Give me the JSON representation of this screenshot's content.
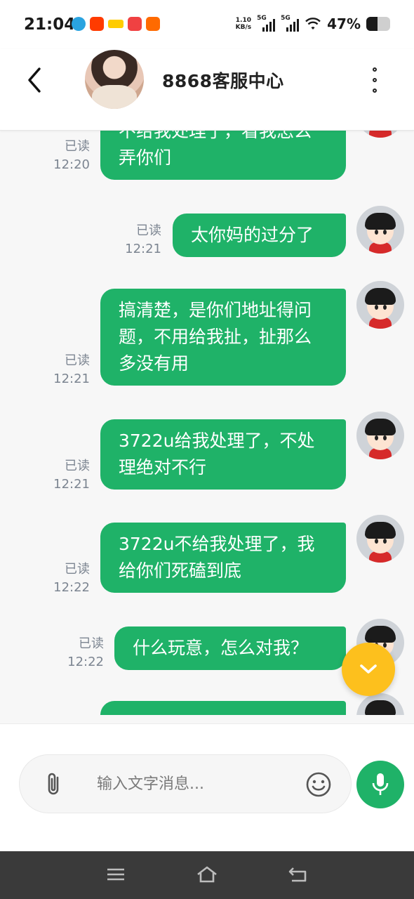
{
  "status_bar": {
    "time": "21:04",
    "net_speed_value": "1.10",
    "net_speed_unit": "KB/s",
    "signal1_label": "5G",
    "signal2_label": "5G",
    "battery_percent": "47%",
    "battery_level": 0.47
  },
  "header": {
    "title": "8868客服中心"
  },
  "messages": [
    {
      "text": "不给我处理了，看我怎么弄你们",
      "status": "已读",
      "time": "12:20"
    },
    {
      "text": "太你妈的过分了",
      "status": "已读",
      "time": "12:21"
    },
    {
      "text": "搞清楚，是你们地址得问题，不用给我扯，扯那么多没有用",
      "status": "已读",
      "time": "12:21"
    },
    {
      "text": "3722u给我处理了，不处理绝对不行",
      "status": "已读",
      "time": "12:21"
    },
    {
      "text": "3722u不给我处理了，我给你们死磕到底",
      "status": "已读",
      "time": "12:22"
    },
    {
      "text": "什么玩意，怎么对我？",
      "status": "已读",
      "time": "12:22"
    },
    {
      "text": "",
      "status": "",
      "time": ""
    }
  ],
  "composer": {
    "placeholder": "输入文字消息..."
  },
  "colors": {
    "bubble": "#1fb268",
    "fab": "#fdc01d",
    "mic": "#1fb268"
  },
  "icons": {
    "back": "chevron-left",
    "menu": "more-vertical",
    "attach": "paperclip",
    "emoji": "smiley",
    "mic": "microphone",
    "scroll_down": "chevron-down"
  }
}
